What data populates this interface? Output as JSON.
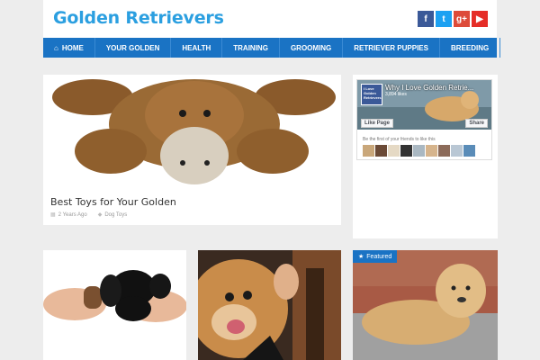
{
  "site": {
    "title": "Golden Retrievers"
  },
  "social": [
    {
      "icon": "facebook-icon",
      "glyph": "f",
      "color": "#3b5998"
    },
    {
      "icon": "twitter-icon",
      "glyph": "t",
      "color": "#1da1f2"
    },
    {
      "icon": "google-plus-icon",
      "glyph": "g+",
      "color": "#dd4b39"
    },
    {
      "icon": "youtube-icon",
      "glyph": "▶",
      "color": "#e52d27"
    }
  ],
  "nav": {
    "items": [
      "Home",
      "Your Golden",
      "Health",
      "Training",
      "Grooming",
      "Retriever Puppies",
      "Breeding"
    ]
  },
  "post": {
    "title": "Best Toys for Your Golden",
    "date": "2 Years Ago",
    "category": "Dog Toys"
  },
  "facebook": {
    "page_name": "Why I Love Golden Retrie...",
    "likes": "3,894 likes",
    "thumb_text": "I Love Golden Retrievers",
    "like_button": "Like Page",
    "share_button": "Share",
    "friends_text": "Be the first of your friends to like this"
  },
  "tiles": {
    "featured_label": "Featured"
  },
  "colors": {
    "brand": "#2b9fe0",
    "nav": "#1a73c4"
  }
}
